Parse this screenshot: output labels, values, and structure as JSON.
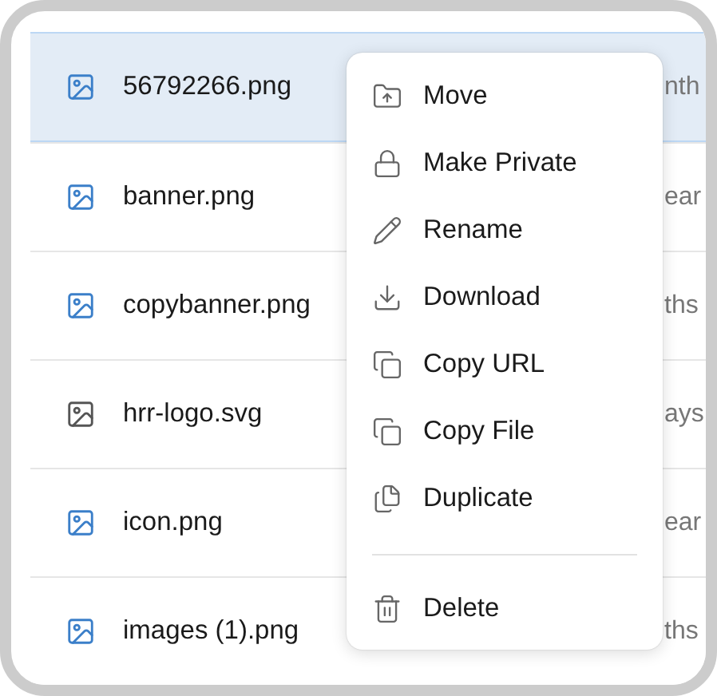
{
  "files": [
    {
      "name": "56792266.png",
      "modified": "nth",
      "selected": true,
      "color": "#3b7fc9"
    },
    {
      "name": "banner.png",
      "modified": "ear",
      "selected": false,
      "color": "#3b7fc9"
    },
    {
      "name": "copybanner.png",
      "modified": "ths",
      "selected": false,
      "color": "#3b7fc9"
    },
    {
      "name": "hrr-logo.svg",
      "modified": "ays",
      "selected": false,
      "color": "#555555"
    },
    {
      "name": "icon.png",
      "modified": "ear",
      "selected": false,
      "color": "#3b7fc9"
    },
    {
      "name": "images (1).png",
      "modified": "ths",
      "selected": false,
      "color": "#3b7fc9"
    }
  ],
  "context_menu": {
    "items": [
      {
        "kind": "move",
        "label": "Move"
      },
      {
        "kind": "lock",
        "label": "Make Private"
      },
      {
        "kind": "rename",
        "label": "Rename"
      },
      {
        "kind": "download",
        "label": "Download"
      },
      {
        "kind": "copy",
        "label": "Copy URL"
      },
      {
        "kind": "copy",
        "label": "Copy File"
      },
      {
        "kind": "duplicate",
        "label": "Duplicate"
      },
      {
        "kind": "separator"
      },
      {
        "kind": "delete",
        "label": "Delete"
      }
    ]
  }
}
